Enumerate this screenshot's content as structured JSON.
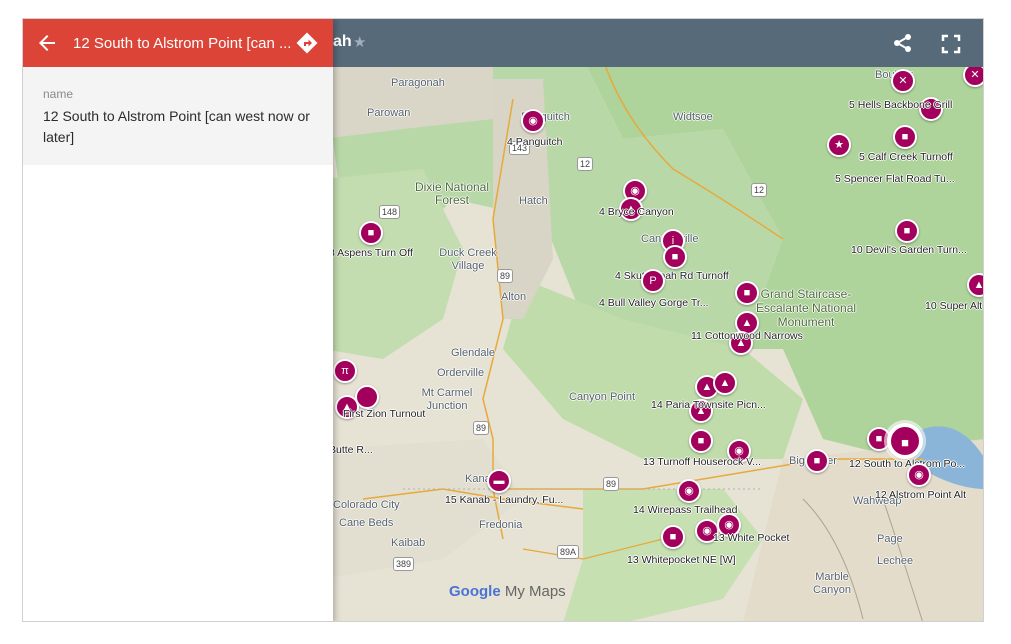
{
  "topbar": {
    "title_fragment": "ah",
    "star_icon": "star-icon",
    "share_icon": "share-icon",
    "fullscreen_icon": "fullscreen-icon"
  },
  "panel": {
    "title": "12 South to Alstrom Point [can ...",
    "back_icon": "arrow-back-icon",
    "directions_icon": "directions-icon",
    "field_label": "name",
    "field_value": "12 South to Alstrom Point [can west now or later]",
    "header_color": "#db4437"
  },
  "map": {
    "brand_google": "Google",
    "brand_mymaps": "My Maps",
    "marker_color": "#a2005c",
    "places": [
      "Paragonah",
      "Parowan",
      "Panguitch",
      "Widtsoe",
      "Dixie National Forest",
      "Hatch",
      "Duck Creek Village",
      "Cannonville",
      "Alton",
      "Grand Staircase-Escalante National Monument",
      "Glendale",
      "Orderville",
      "Mt Carmel Junction",
      "Canyon Point",
      "Kanab",
      "Fredonia",
      "Kaibab",
      "Cane Beds",
      "Big Water",
      "Wahweap",
      "Page",
      "Lechee",
      "Marble Canyon",
      "Boulder",
      "Colorado City"
    ],
    "routes": [
      "143",
      "148",
      "89",
      "89",
      "12",
      "12",
      "89",
      "389",
      "89A"
    ],
    "labels": [
      "4 Panguitch",
      "4 Bryce Canyon",
      "3 Aspens Turn Off",
      "4 Skutumpah Rd Turnoff",
      "4 Bull Valley Gorge Tr...",
      "11 Cottonwood Narrows",
      "14 Paria Townsite Picn...",
      "First Zion Turnout",
      "Butte R...",
      "13 Turnoff Houserock V...",
      "15 Kanab - Laundry, Fu...",
      "14 Wirepass Trailhead",
      "13 White Pocket",
      "13 Whitepocket NE [W]",
      "5 Hells Backbone Grill",
      "5 Calf Creek Turnoff",
      "5 Spencer Flat Road Tu...",
      "10 Devil's Garden Turn...",
      "10 Super Alt",
      "12 South to Alstrom Po...",
      "12 Alstrom Point Alt"
    ]
  }
}
